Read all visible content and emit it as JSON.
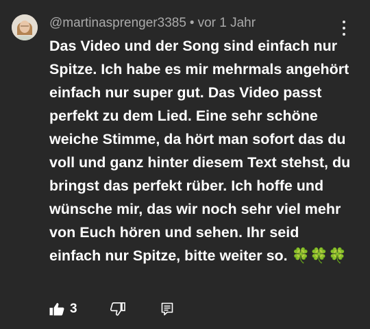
{
  "comment": {
    "author": "@martinasprenger3385",
    "separator": "•",
    "timestamp": "vor 1 Jahr",
    "text": "Das Video und der Song sind einfach nur Spitze. Ich habe es mir mehrmals angehört einfach nur super gut. Das Video passt perfekt zu dem Lied. Eine sehr schöne weiche Stimme, da hört man sofort das du voll und ganz hinter diesem Text stehst, du bringst das perfekt rüber. Ich hoffe und wünsche mir, das wir noch sehr viel mehr von Euch hören und sehen. Ihr seid einfach nur Spitze, bitte weiter so. 🍀🍀🍀",
    "like_count": "3"
  },
  "icons": {
    "menu": "more-vert-icon",
    "like": "thumb-up-filled-icon",
    "dislike": "thumb-down-outline-icon",
    "reply": "comment-reply-icon"
  },
  "colors": {
    "background": "#282828",
    "text_primary": "#ffffff",
    "text_secondary": "#aaaaaa"
  }
}
